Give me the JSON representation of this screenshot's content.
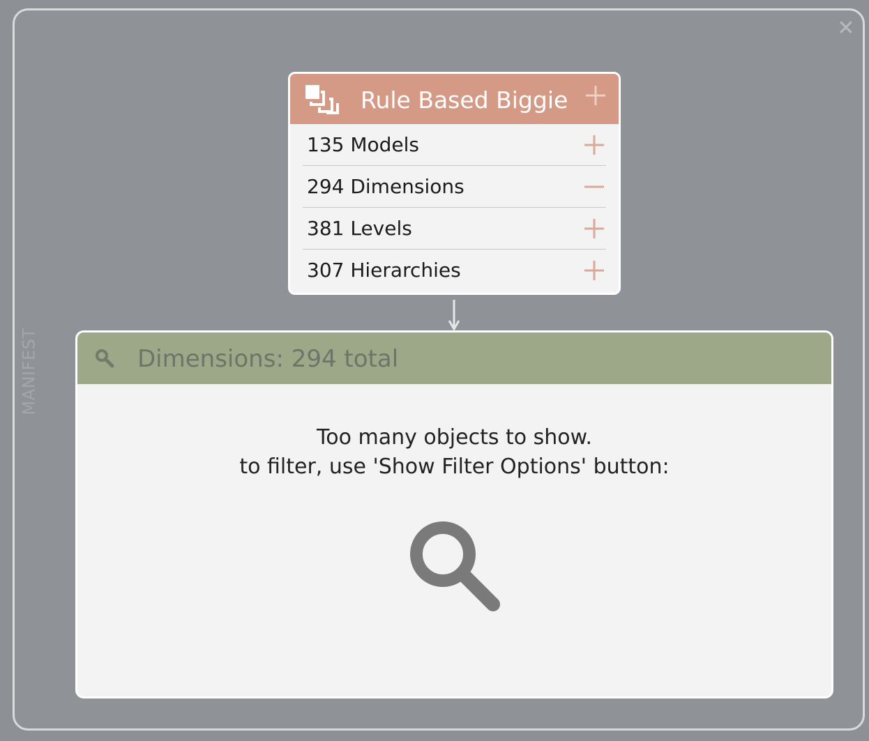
{
  "window": {
    "side_label": "MANIFEST",
    "close_symbol": "✕"
  },
  "model_card": {
    "title": "Rule Based Biggie",
    "icon": "layers-icon",
    "header_color": "#d49a86",
    "rows": [
      {
        "label": "135 Models",
        "action": "plus"
      },
      {
        "label": "294 Dimensions",
        "action": "minus"
      },
      {
        "label": "381 Levels",
        "action": "plus"
      },
      {
        "label": "307 Hierarchies",
        "action": "plus"
      }
    ]
  },
  "dimensions_panel": {
    "title": "Dimensions: 294 total",
    "header_color": "#9ca887",
    "message_line1": "Too many objects to show.",
    "message_line2": "to filter, use 'Show Filter Options' button:",
    "filter_icon": "search-icon"
  },
  "colors": {
    "background": "#8d9095",
    "accent_salmon": "#d49a86",
    "accent_green": "#9ca887"
  }
}
